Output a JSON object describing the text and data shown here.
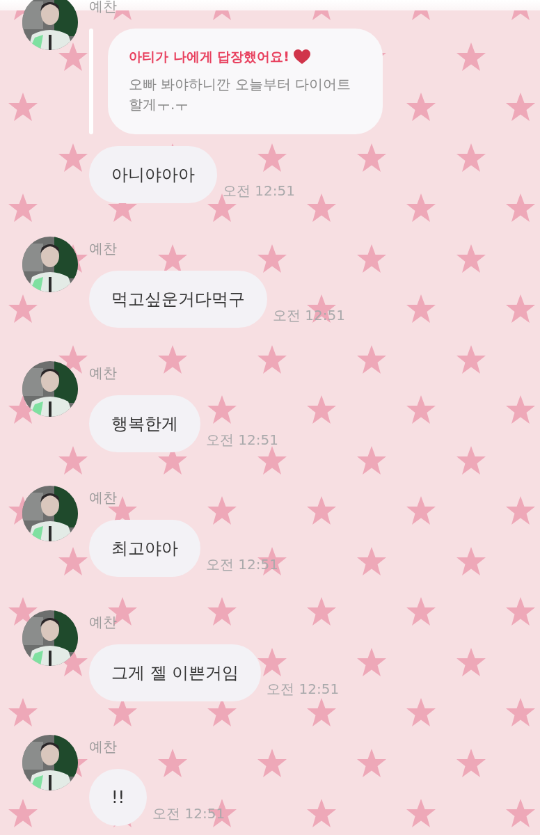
{
  "groups": [
    {
      "sender": "예찬",
      "reply": {
        "title": "아티가 나에게 답장했어요!",
        "text": "오빠 봐야하니깐 오늘부터 다이어트 할게ㅜ.ㅜ"
      },
      "bubbles": [
        "아니야아아"
      ],
      "time": "오전 12:51"
    },
    {
      "sender": "예찬",
      "bubbles": [
        "먹고싶운거다먹구"
      ],
      "time": "오전 12:51"
    },
    {
      "sender": "예찬",
      "bubbles": [
        "행복한게"
      ],
      "time": "오전 12:51"
    },
    {
      "sender": "예찬",
      "bubbles": [
        "최고야아"
      ],
      "time": "오전 12:51"
    },
    {
      "sender": "예찬",
      "bubbles": [
        "그게 젤 이쁜거임"
      ],
      "time": "오전 12:51"
    },
    {
      "sender": "예찬",
      "bubbles": [
        "!!"
      ],
      "time": "오전 12:51"
    }
  ]
}
